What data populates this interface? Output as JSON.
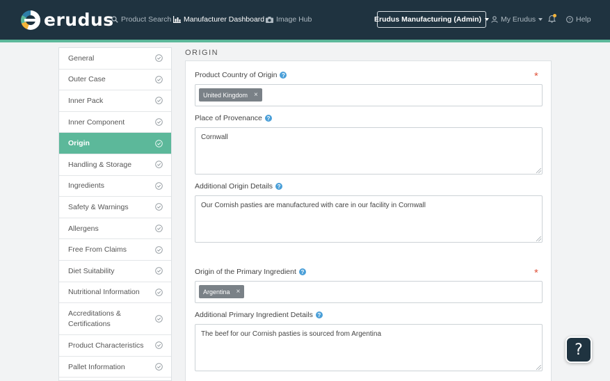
{
  "header": {
    "brand": "erudus",
    "nav": {
      "product_search": "Product Search",
      "manufacturer_dashboard": "Manufacturer Dashboard",
      "image_hub": "Image Hub"
    },
    "org_selector": "Erudus Manufacturing (Admin)",
    "account": "My Erudus",
    "help": "Help",
    "colors": {
      "bar": "#1f3340",
      "accent": "#5cb89a",
      "notification": "#f4b43a"
    }
  },
  "sidebar": {
    "items": [
      {
        "label": "General"
      },
      {
        "label": "Outer Case"
      },
      {
        "label": "Inner Pack"
      },
      {
        "label": "Inner Component"
      },
      {
        "label": "Origin"
      },
      {
        "label": "Handling & Storage"
      },
      {
        "label": "Ingredients"
      },
      {
        "label": "Safety & Warnings"
      },
      {
        "label": "Allergens"
      },
      {
        "label": "Free From Claims"
      },
      {
        "label": "Diet Suitability"
      },
      {
        "label": "Nutritional Information"
      },
      {
        "label": "Accreditations & Certifications"
      },
      {
        "label": "Product Characteristics"
      },
      {
        "label": "Pallet Information"
      }
    ],
    "active": "Origin"
  },
  "main": {
    "section_title": "ORIGIN",
    "fields": {
      "country_of_origin": {
        "label": "Product Country of Origin",
        "required": "*",
        "tag": "United Kingdom",
        "tag_remove": "×"
      },
      "place_of_provenance": {
        "label": "Place of Provenance",
        "value": "Cornwall"
      },
      "additional_origin": {
        "label": "Additional Origin Details",
        "value": "Our Cornish pasties are manufactured with care in our facility in Cornwall"
      },
      "primary_ingredient_origin": {
        "label": "Origin of the Primary Ingredient",
        "required": "*",
        "tag": "Argentina",
        "tag_remove": "×"
      },
      "additional_primary": {
        "label": "Additional Primary Ingredient Details",
        "value": "The beef for our Cornish pasties is sourced from Argentina"
      }
    },
    "help_glyph": "?"
  },
  "floating_help": "?"
}
